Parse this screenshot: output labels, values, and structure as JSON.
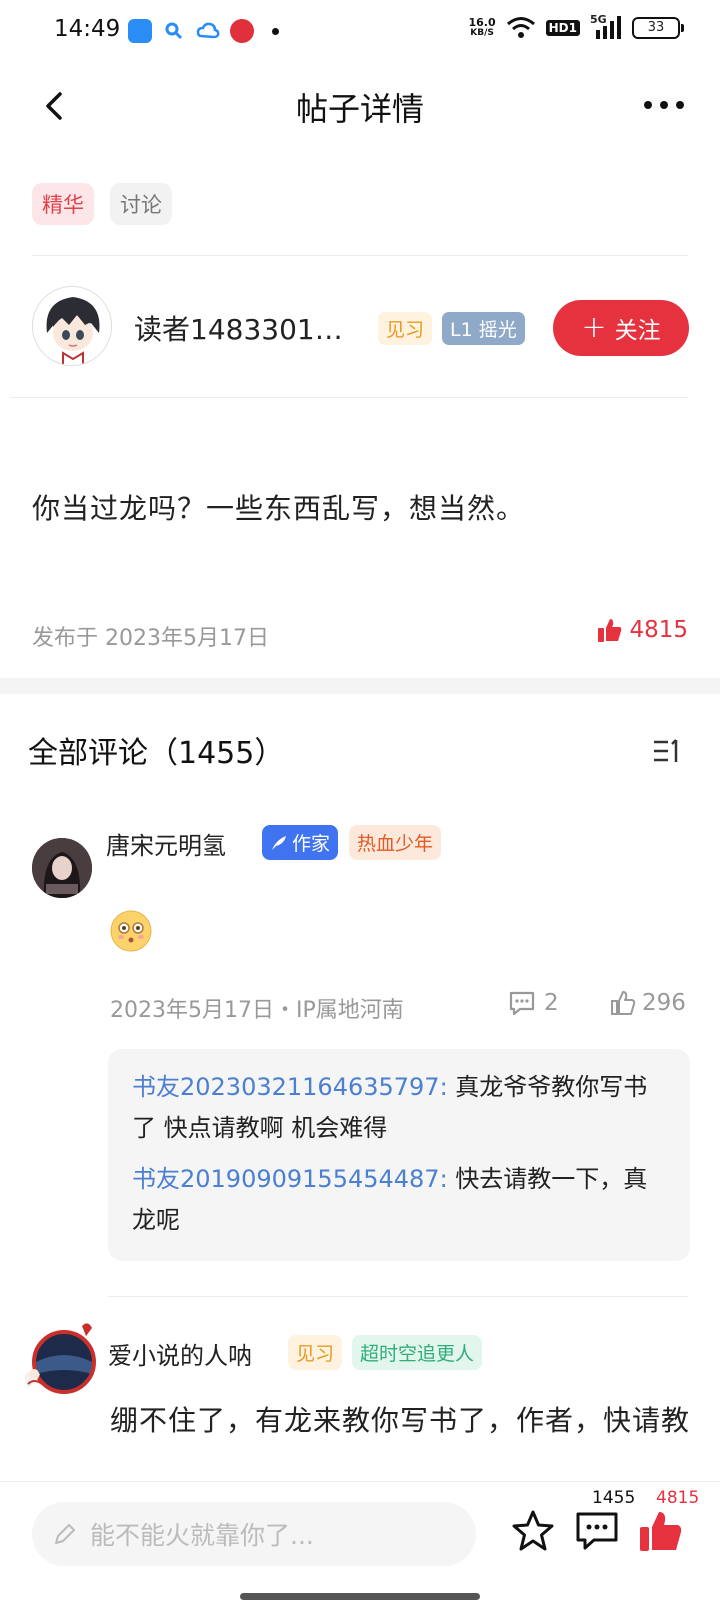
{
  "status_bar": {
    "time": "14:49",
    "net_speed_value": "16.0",
    "net_speed_unit": "KB/S",
    "hd_label": "HD1",
    "signal_label": "5G",
    "battery": "33"
  },
  "nav": {
    "title": "帖子详情"
  },
  "tags": {
    "essence": "精华",
    "discuss": "讨论"
  },
  "author": {
    "name": "读者1483301…",
    "level_badge": "见习",
    "rank_badge": "L1 摇光",
    "follow_label": "关注"
  },
  "post": {
    "content": "你当过龙吗？一些东西乱写，想当然。",
    "date": "发布于 2023年5月17日",
    "likes": "4815"
  },
  "comments": {
    "title": "全部评论（1455）",
    "items": [
      {
        "user": "唐宋元明氢",
        "badge_writer": "作家",
        "badge_title": "热血少年",
        "meta": "2023年5月17日・IP属地河南",
        "reply_count": "2",
        "like_count": "296",
        "replies": [
          {
            "user": "书友20230321164635797:",
            "text": " 真龙爷爷教你写书了  快点请教啊  机会难得"
          },
          {
            "user": "书友20190909155454487:",
            "text": " 快去请教一下，真龙呢"
          }
        ]
      },
      {
        "user": "爱小说的人呐",
        "badge_level": "见习",
        "badge_title": "超时空追更人",
        "text": "绷不住了，有龙来教你写书了，作者，快请教"
      }
    ]
  },
  "bottom_bar": {
    "input_placeholder": "能不能火就靠你了...",
    "comment_count": "1455",
    "like_count": "4815"
  },
  "colors": {
    "accent_red": "#e6323f",
    "link_blue": "#4a7fd1",
    "writer_blue": "#3f73f0"
  }
}
